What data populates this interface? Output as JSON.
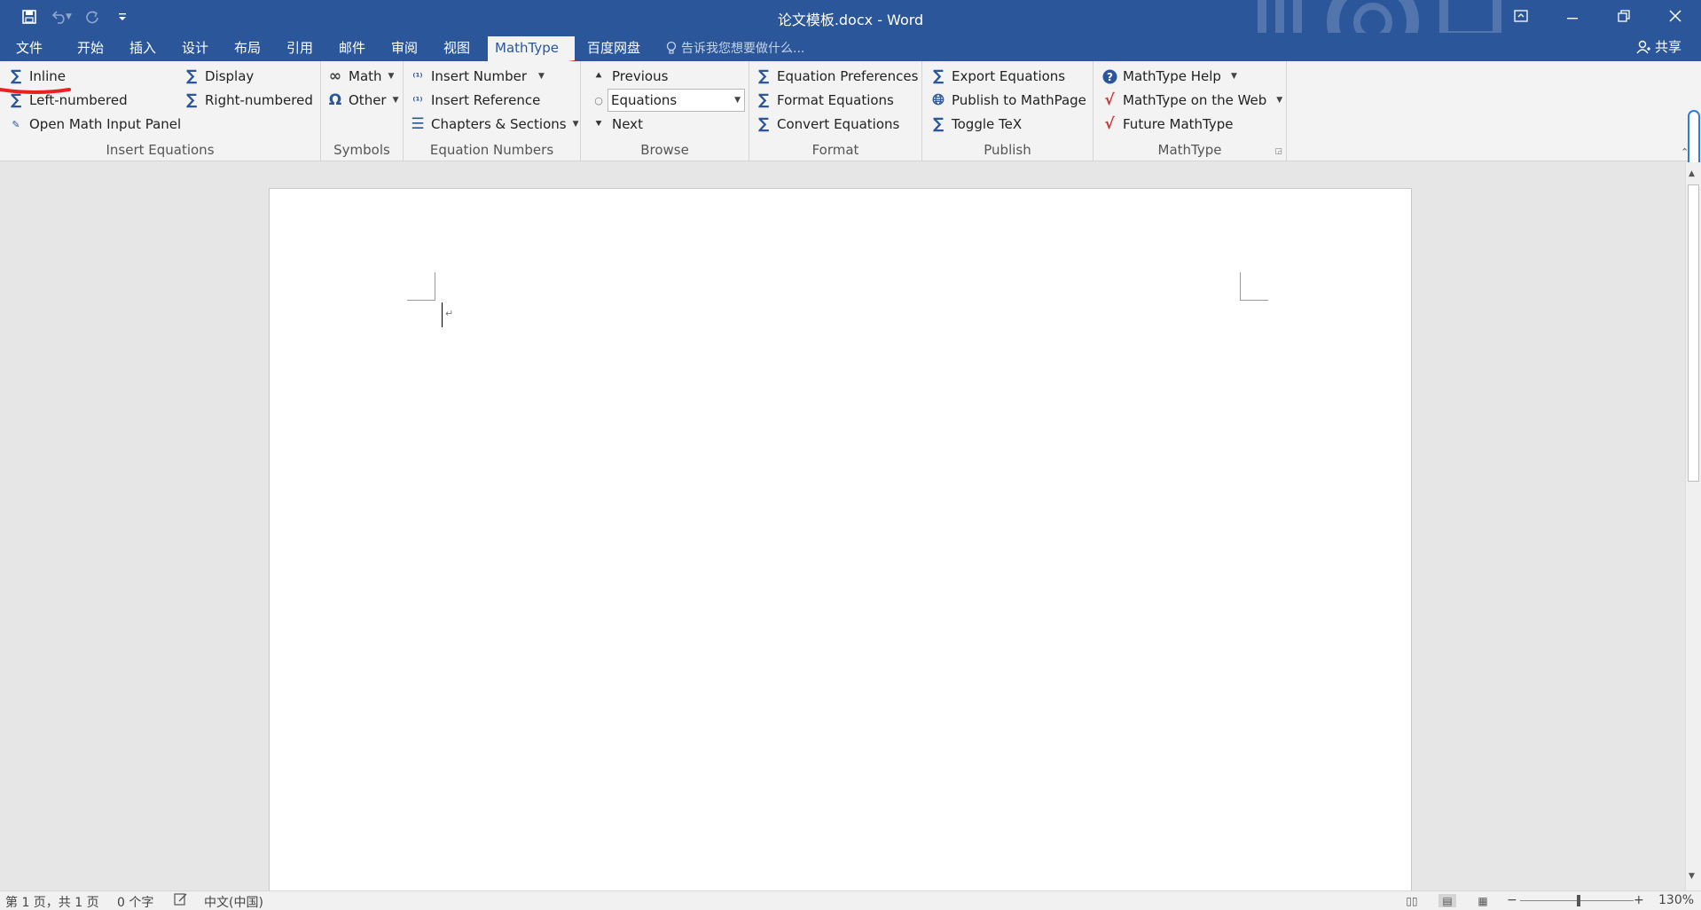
{
  "window": {
    "title": "论文模板.docx - Word"
  },
  "tabs": [
    {
      "label": "文件"
    },
    {
      "label": "开始"
    },
    {
      "label": "插入"
    },
    {
      "label": "设计"
    },
    {
      "label": "布局"
    },
    {
      "label": "引用"
    },
    {
      "label": "邮件"
    },
    {
      "label": "审阅"
    },
    {
      "label": "视图"
    },
    {
      "label": "MathType"
    },
    {
      "label": "百度网盘"
    }
  ],
  "tell_me": "告诉我您想要做什么...",
  "share": "共享",
  "ribbon": {
    "insert_equations": {
      "label": "Insert Equations",
      "inline": "Inline",
      "display": "Display",
      "left_numbered": "Left-numbered",
      "right_numbered": "Right-numbered",
      "open_math_input": "Open Math Input Panel"
    },
    "symbols": {
      "label": "Symbols",
      "math": "Math",
      "other": "Other"
    },
    "equation_numbers": {
      "label": "Equation Numbers",
      "insert_number": "Insert Number",
      "insert_reference": "Insert Reference",
      "chapters_sections": "Chapters & Sections"
    },
    "browse": {
      "label": "Browse",
      "previous": "Previous",
      "selected": "Equations",
      "next": "Next"
    },
    "format": {
      "label": "Format",
      "equation_preferences": "Equation Preferences",
      "format_equations": "Format Equations",
      "convert_equations": "Convert Equations"
    },
    "publish": {
      "label": "Publish",
      "export_equations": "Export Equations",
      "publish_mathpage": "Publish to MathPage",
      "toggle_tex": "Toggle TeX"
    },
    "mathtype": {
      "label": "MathType",
      "help": "MathType Help",
      "on_web": "MathType on the Web",
      "future": "Future MathType"
    }
  },
  "status": {
    "page": "第 1 页，共 1 页",
    "words": "0 个字",
    "language": "中文(中国)",
    "zoom": "130%",
    "zoom_minus": "−",
    "zoom_plus": "+"
  },
  "colors": {
    "word_blue": "#2b579a",
    "annotation_red": "#e8231f"
  }
}
